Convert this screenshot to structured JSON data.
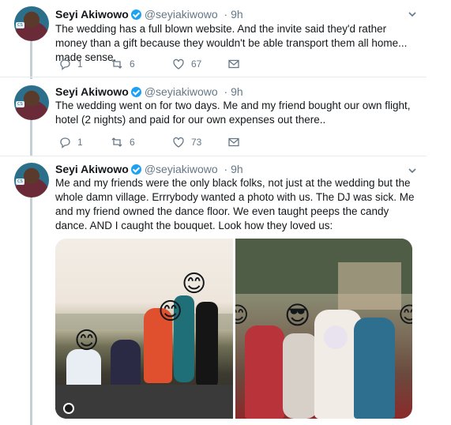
{
  "tweets": [
    {
      "name": "Seyi Akiwowo",
      "handle": "@seyiakiwowo",
      "time": "· 9h",
      "text": "The wedding has a full blown website. And the invite said they'd rather money than a gift because they wouldn't be able transport them all home... made sense.",
      "replies": "1",
      "retweets": "6",
      "likes": "67"
    },
    {
      "name": "Seyi Akiwowo",
      "handle": "@seyiakiwowo",
      "time": "· 9h",
      "text": "The wedding went on for two days. Me and my friend bought our own flight, hotel (2 nights) and paid for our own expenses out there..",
      "replies": "1",
      "retweets": "6",
      "likes": "73"
    },
    {
      "name": "Seyi Akiwowo",
      "handle": "@seyiakiwowo",
      "time": "· 9h",
      "text": "Me and my friends were the only black folks, not just at the wedding but the whole damn village. Errrybody wanted a photo with us. The DJ was sick. Me and my friend owned the dance floor. We even taught peeps the candy dance. AND I caught the bouquet. Look how they loved us:"
    }
  ],
  "icons": {
    "verified": "verified-badge-icon",
    "reply": "reply-icon",
    "retweet": "retweet-icon",
    "like": "heart-icon",
    "dm": "envelope-icon",
    "more": "chevron-down-icon"
  },
  "colors": {
    "accent": "#1da1f2",
    "muted": "#657786",
    "thread_line": "#c4cfd6"
  }
}
